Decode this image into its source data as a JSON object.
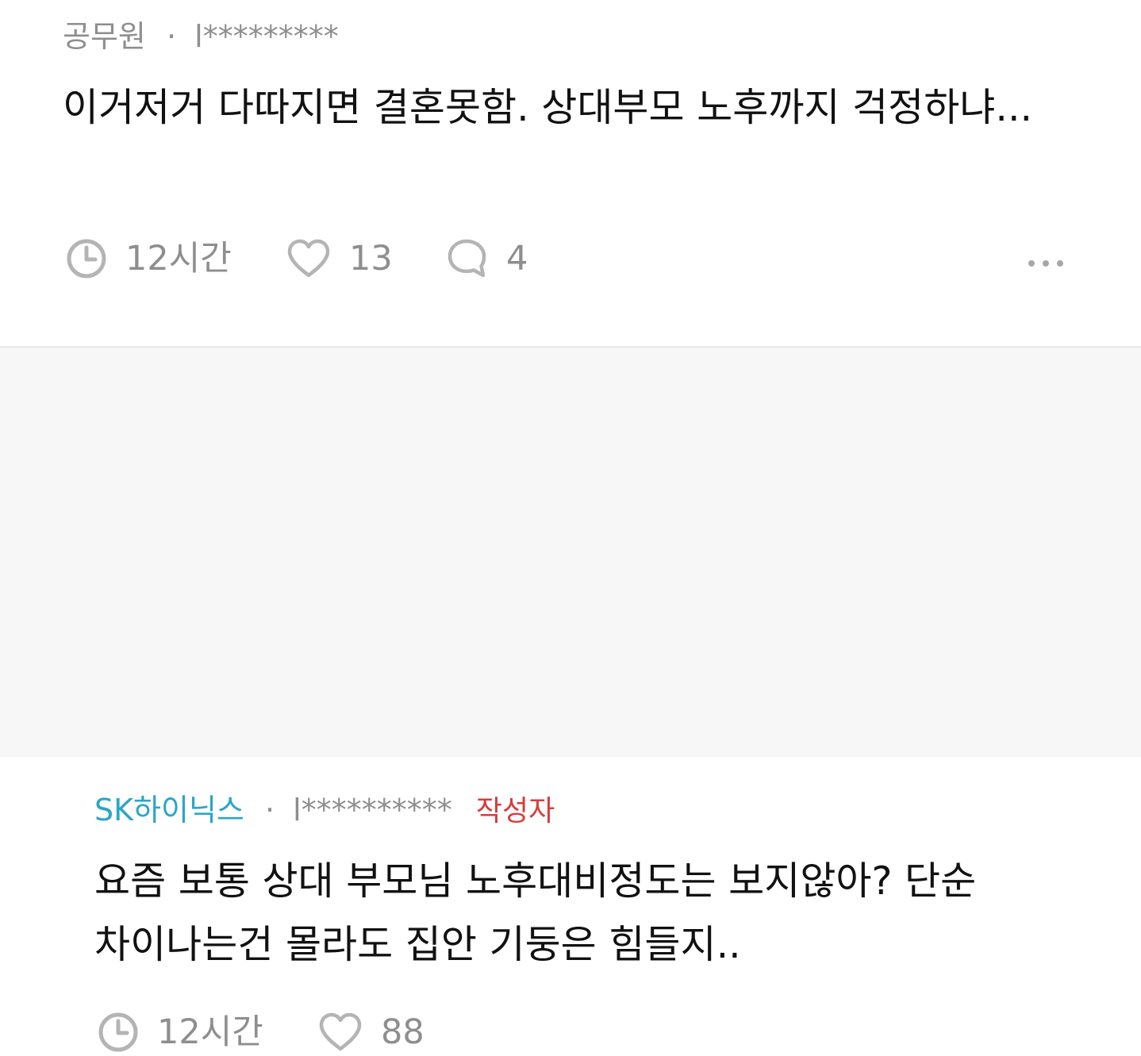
{
  "comments": [
    {
      "company": "공무원",
      "separator": "·",
      "nickname": "l*********",
      "body": "이거저거 다따지면 결혼못함. 상대부모 노후까지 걱정하냐...",
      "time": "12시간",
      "likes": "13",
      "replies": "4",
      "more_icon": "more-horizontal-icon",
      "colors": {
        "company": "#8e8e8e",
        "text": "#111111",
        "meta": "#8e8e8e",
        "background": "#ffffff"
      }
    },
    {
      "company": "SK하이닉스",
      "separator": "·",
      "nickname": "l**********",
      "author_badge": "작성자",
      "body": "요즘 보통 상대 부모님 노후대비정도는 보지않아? 단순 차이나는건 몰라도 집안 기둥은 힘들지..",
      "time": "12시간",
      "likes": "88",
      "colors": {
        "company": "#2aa6c7",
        "author_badge": "#d83c3c",
        "text": "#111111",
        "meta": "#8e8e8e",
        "background": "#f7f7f7"
      }
    }
  ],
  "icons": {
    "time": "clock-icon",
    "like": "heart-icon",
    "reply": "comment-bubble-icon",
    "more": "ellipsis-icon"
  }
}
